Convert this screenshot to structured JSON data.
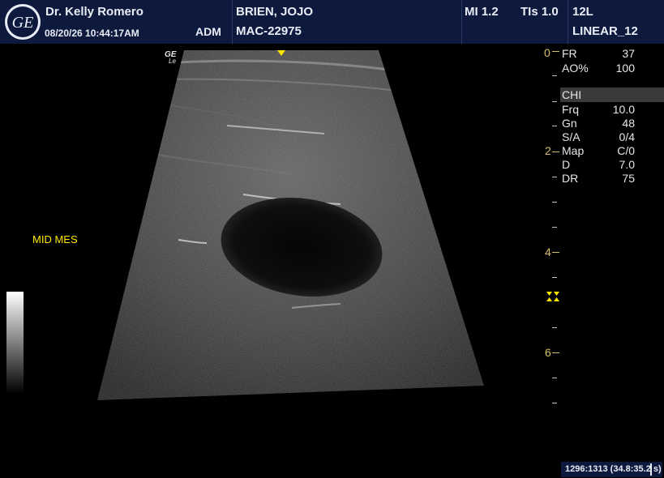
{
  "header": {
    "logo": "GE",
    "physician": "Dr. Kelly Romero",
    "datetime": "08/20/26 10:44:17AM",
    "operator": "ADM",
    "patient_name": "BRIEN, JOJO",
    "patient_id": "MAC-22975",
    "mi": "MI 1.2",
    "tis": "TIs 1.0",
    "probe": "12L",
    "preset": "LINEAR_12"
  },
  "image": {
    "annotation": "MID MES",
    "orientation_marker": "GE Le"
  },
  "params": {
    "fr_label": "FR",
    "fr_value": "37",
    "ao_label": "AO%",
    "ao_value": "100",
    "mode": "CHI",
    "frq_label": "Frq",
    "frq_value": "10.0",
    "gn_label": "Gn",
    "gn_value": "48",
    "sa_label": "S/A",
    "sa_value": "0/4",
    "map_label": "Map",
    "map_value": "C/0",
    "d_label": "D",
    "d_value": "7.0",
    "dr_label": "DR",
    "dr_value": "75"
  },
  "depth_scale": {
    "labels": [
      "0",
      "2",
      "4",
      "6"
    ],
    "focus_marker": "focus-zone-icon"
  },
  "status": {
    "text": "1296:1313 (34.8:35.2 s)"
  },
  "colors": {
    "header_bg": "#0d1a3d",
    "annotation_yellow": "#ffe600",
    "depth_scale": "#d8c06a"
  }
}
